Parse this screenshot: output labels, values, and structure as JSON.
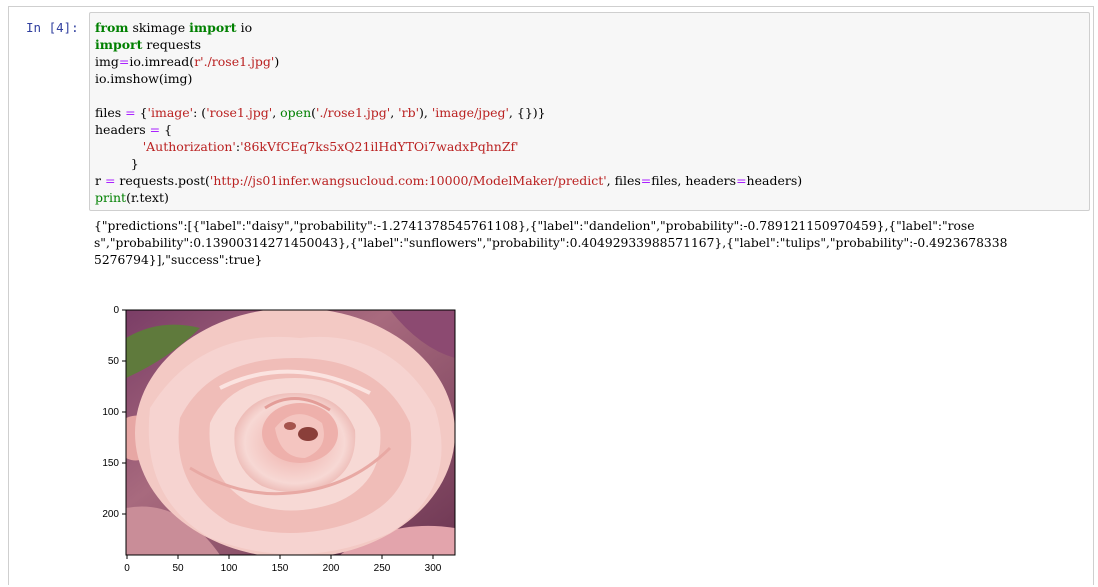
{
  "cell": {
    "prompt": "In  [4]:",
    "code_lines": [
      [
        {
          "t": "from",
          "c": "kw"
        },
        {
          "t": " skimage "
        },
        {
          "t": "import",
          "c": "kw"
        },
        {
          "t": " io"
        }
      ],
      [
        {
          "t": "import",
          "c": "kw"
        },
        {
          "t": " requests"
        }
      ],
      [
        {
          "t": "img"
        },
        {
          "t": "=",
          "c": "op"
        },
        {
          "t": "io.imread("
        },
        {
          "t": "r'./rose1.jpg'",
          "c": "st"
        },
        {
          "t": ")"
        }
      ],
      [
        {
          "t": "io.imshow(img)"
        }
      ],
      [
        {
          "t": ""
        }
      ],
      [
        {
          "t": "files "
        },
        {
          "t": "=",
          "c": "op"
        },
        {
          "t": " {"
        },
        {
          "t": "'image'",
          "c": "st"
        },
        {
          "t": ": ("
        },
        {
          "t": "'rose1.jpg'",
          "c": "st"
        },
        {
          "t": ", "
        },
        {
          "t": "open",
          "c": "bi"
        },
        {
          "t": "("
        },
        {
          "t": "'./rose1.jpg'",
          "c": "st"
        },
        {
          "t": ", "
        },
        {
          "t": "'rb'",
          "c": "st"
        },
        {
          "t": "), "
        },
        {
          "t": "'image/jpeg'",
          "c": "st"
        },
        {
          "t": ", {})}"
        }
      ],
      [
        {
          "t": "headers "
        },
        {
          "t": "=",
          "c": "op"
        },
        {
          "t": " {"
        }
      ],
      [
        {
          "t": "            "
        },
        {
          "t": "'Authorization'",
          "c": "st"
        },
        {
          "t": ":"
        },
        {
          "t": "'86kVfCEq7ks5xQ21ilHdYTOi7wadxPqhnZf'",
          "c": "st"
        }
      ],
      [
        {
          "t": "         }"
        }
      ],
      [
        {
          "t": "r "
        },
        {
          "t": "=",
          "c": "op"
        },
        {
          "t": " requests.post("
        },
        {
          "t": "'http://js01infer.wangsucloud.com:10000/ModelMaker/predict'",
          "c": "st"
        },
        {
          "t": ", files"
        },
        {
          "t": "=",
          "c": "op"
        },
        {
          "t": "files, headers"
        },
        {
          "t": "=",
          "c": "op"
        },
        {
          "t": "headers)"
        }
      ],
      [
        {
          "t": "print",
          "c": "bi"
        },
        {
          "t": "(r.text)"
        }
      ]
    ],
    "output_lines": [
      "{\"predictions\":[{\"label\":\"daisy\",\"probability\":-1.2741378545761108},{\"label\":\"dandelion\",\"probability\":-0.789121150970459},{\"label\":\"rose",
      "s\",\"probability\":0.13900314271450043},{\"label\":\"sunflowers\",\"probability\":0.40492933988571167},{\"label\":\"tulips\",\"probability\":-0.4923678338",
      "5276794}],\"success\":true}"
    ]
  },
  "plot": {
    "image_subject": "pink rose photograph",
    "y_ticks": [
      "0",
      "50",
      "100",
      "150",
      "200"
    ],
    "x_ticks": [
      "0",
      "50",
      "100",
      "150",
      "200",
      "250",
      "300"
    ],
    "colors": {
      "rose_light": "#f6d3d0",
      "rose_mid": "#eaa9a6",
      "rose_dark": "#c7766f",
      "background_purple": "#7a3d66",
      "leaf_green": "#5f7a3c"
    }
  }
}
